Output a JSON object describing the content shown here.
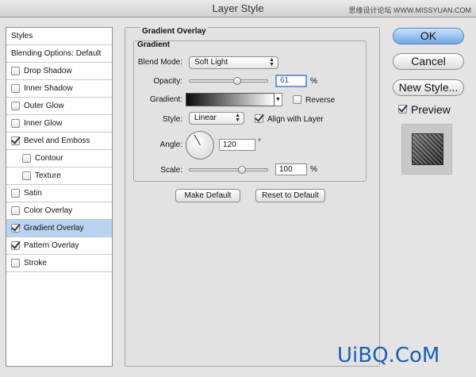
{
  "window": {
    "title": "Layer Style",
    "watermark_top": "思缘设计论坛 WWW.MISSYUAN.COM"
  },
  "sidebar": {
    "header": "Styles",
    "blending": "Blending Options: Default",
    "items": [
      {
        "label": "Drop Shadow",
        "checked": false
      },
      {
        "label": "Inner Shadow",
        "checked": false
      },
      {
        "label": "Outer Glow",
        "checked": false
      },
      {
        "label": "Inner Glow",
        "checked": false
      },
      {
        "label": "Bevel and Emboss",
        "checked": true
      },
      {
        "label": "Contour",
        "checked": false
      },
      {
        "label": "Texture",
        "checked": false
      },
      {
        "label": "Satin",
        "checked": false
      },
      {
        "label": "Color Overlay",
        "checked": false
      },
      {
        "label": "Gradient Overlay",
        "checked": true
      },
      {
        "label": "Pattern Overlay",
        "checked": true
      },
      {
        "label": "Stroke",
        "checked": false
      }
    ]
  },
  "panel": {
    "title": "Gradient Overlay",
    "group": "Gradient",
    "blend_mode_label": "Blend Mode:",
    "blend_mode": "Soft Light",
    "opacity_label": "Opacity:",
    "opacity": "61",
    "opacity_unit": "%",
    "opacity_level": 0.61,
    "gradient_label": "Gradient:",
    "reverse_label": "Reverse",
    "style_label": "Style:",
    "style": "Linear",
    "align_label": "Align with Layer",
    "angle_label": "Angle:",
    "angle": "120",
    "angle_unit": "°",
    "scale_label": "Scale:",
    "scale": "100",
    "scale_unit": "%",
    "scale_level": 0.67,
    "make_default": "Make Default",
    "reset_default": "Reset to Default"
  },
  "actions": {
    "ok": "OK",
    "cancel": "Cancel",
    "new_style": "New Style...",
    "preview": "Preview"
  },
  "colors": {
    "selected_row": "#b9d4f0",
    "ok_button": "#6fa7e5",
    "watermark": "#1d5fb4"
  },
  "brand": {
    "watermark": "UiBQ.CoM"
  }
}
